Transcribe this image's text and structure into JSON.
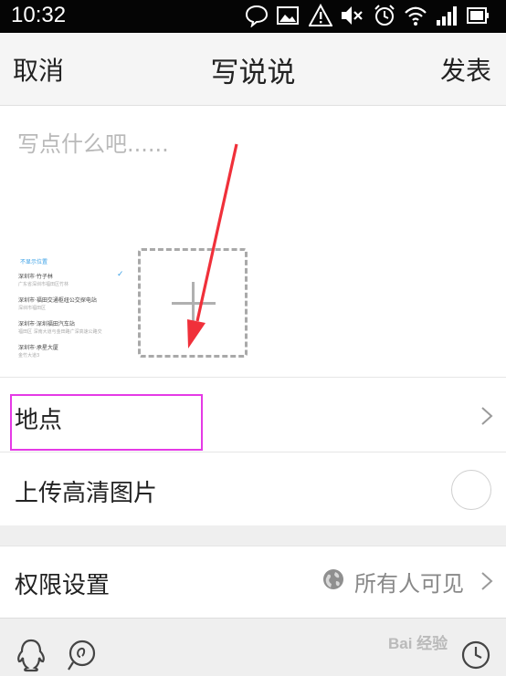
{
  "status_bar": {
    "time": "10:32",
    "icons": [
      "chat-bubble-icon",
      "image-icon",
      "warning-icon",
      "mute-icon",
      "alarm-icon",
      "wifi-icon",
      "signal-icon",
      "battery-icon"
    ]
  },
  "nav": {
    "cancel": "取消",
    "title": "写说说",
    "publish": "发表"
  },
  "compose": {
    "placeholder": "写点什么吧......",
    "location_preview": {
      "header": "不显示位置",
      "items": [
        {
          "name": "深圳市·竹子林",
          "sub": "广东省深圳市福田区竹林"
        },
        {
          "name": "深圳市·福田交通枢纽公交探电站",
          "sub": "深圳市福田区"
        },
        {
          "name": "深圳市·深圳福田汽车站",
          "sub": "福田区 深南大道与金田路广深高速公路交"
        },
        {
          "name": "深圳市·承星大厦",
          "sub": "金竹大道3"
        }
      ]
    }
  },
  "rows": {
    "location": "地点",
    "hd_upload": "上传高清图片",
    "permission": "权限设置",
    "permission_value": "所有人可见"
  },
  "bottom_bar": {
    "icons": [
      "qq-penguin-icon",
      "mention-icon",
      "clock-icon"
    ]
  },
  "watermark": "Bai 经验",
  "colors": {
    "status_bar_bg": "#050505",
    "nav_bg": "#f5f5f5",
    "highlight": "#e53ae6",
    "arrow": "#f0303a",
    "link_blue": "#3aa0e6"
  }
}
